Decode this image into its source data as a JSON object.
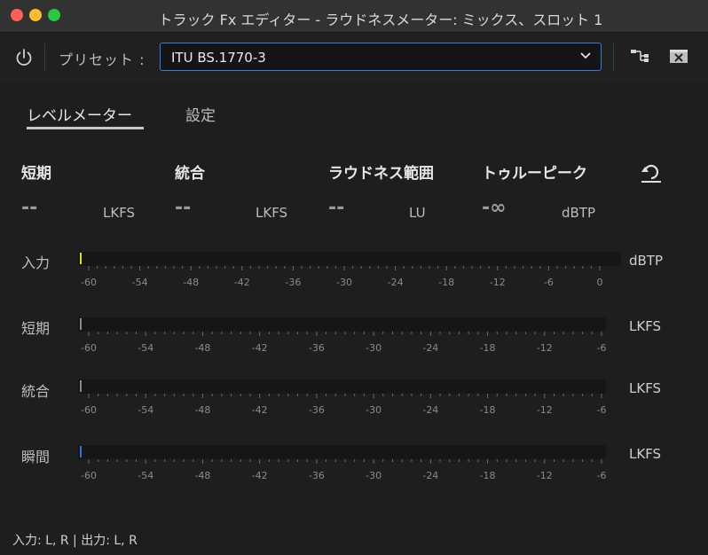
{
  "window": {
    "title": "トラック Fx エディター - ラウドネスメーター: ミックス、スロット 1"
  },
  "toolbar": {
    "preset_label": "プリセット :",
    "preset_value": "ITU BS.1770-3"
  },
  "tabs": [
    {
      "label": "レベルメーター",
      "active": true
    },
    {
      "label": "設定",
      "active": false
    }
  ],
  "metrics": [
    {
      "title": "短期",
      "value": "--",
      "unit": "LKFS"
    },
    {
      "title": "統合",
      "value": "--",
      "unit": "LKFS"
    },
    {
      "title": "ラウドネス範囲",
      "value": "--",
      "unit": "LU"
    },
    {
      "title": "トゥルーピーク",
      "value": "-∞",
      "unit": "dBTP"
    }
  ],
  "meters": [
    {
      "label": "入力",
      "unit": "dBTP",
      "ticks": [
        "-60",
        "-54",
        "-48",
        "-42",
        "-36",
        "-30",
        "-24",
        "-18",
        "-12",
        "-6",
        "0"
      ],
      "indicator_color": "#e6e200"
    },
    {
      "label": "短期",
      "unit": "LKFS",
      "ticks": [
        "-60",
        "-54",
        "-48",
        "-42",
        "-36",
        "-30",
        "-24",
        "-18",
        "-12",
        "-6"
      ],
      "indicator_color": "#8a8a8a"
    },
    {
      "label": "統合",
      "unit": "LKFS",
      "ticks": [
        "-60",
        "-54",
        "-48",
        "-42",
        "-36",
        "-30",
        "-24",
        "-18",
        "-12",
        "-6"
      ],
      "indicator_color": "#8a8a8a"
    },
    {
      "label": "瞬間",
      "unit": "LKFS",
      "ticks": [
        "-60",
        "-54",
        "-48",
        "-42",
        "-36",
        "-30",
        "-24",
        "-18",
        "-12",
        "-6"
      ],
      "indicator_color": "#3a6ee0"
    }
  ],
  "footer": {
    "io_text": "入力: L, R | 出力: L, R"
  },
  "icons": {
    "power": "power-icon",
    "routing": "routing-icon",
    "close_panel": "close-panel-icon",
    "chevron": "chevron-down-icon",
    "reset": "reset-icon"
  }
}
